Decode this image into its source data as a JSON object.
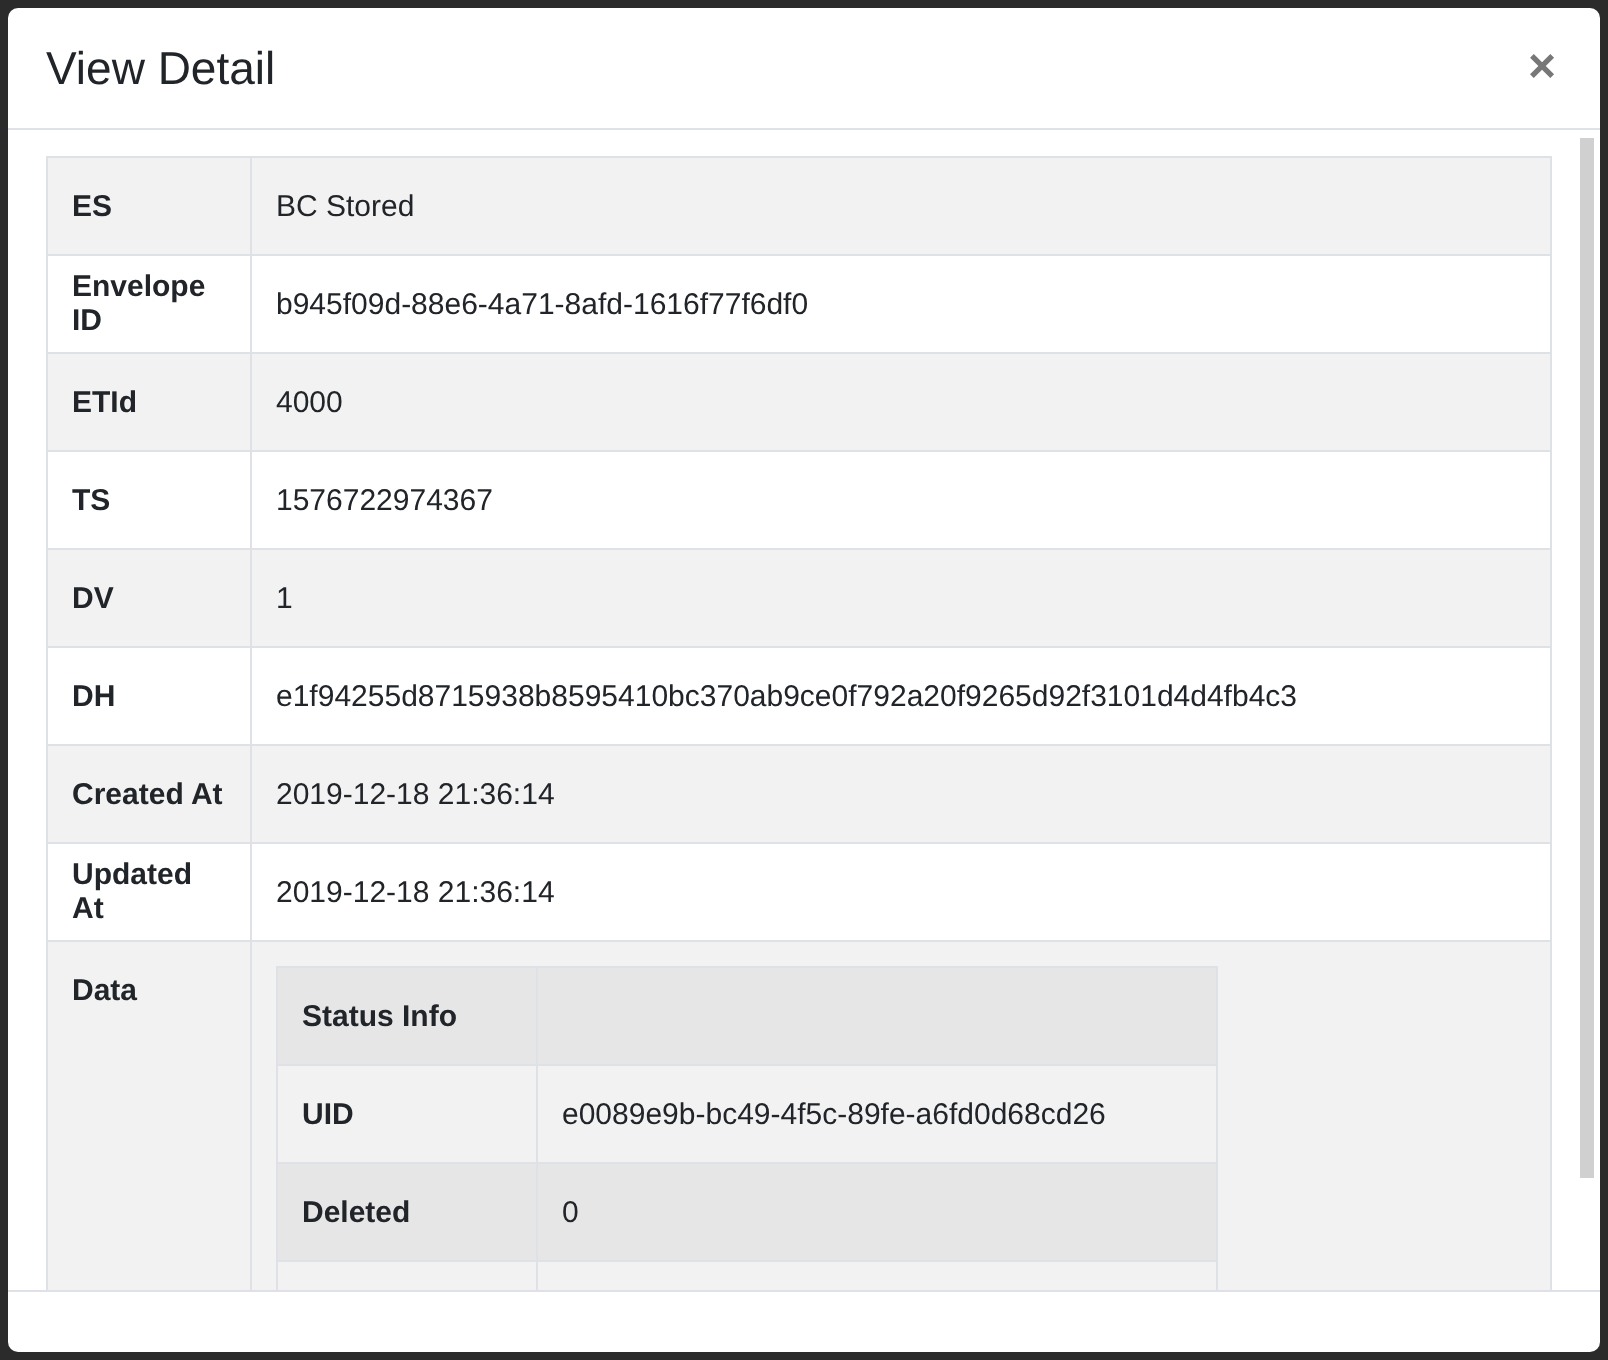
{
  "modal": {
    "title": "View Detail",
    "close": "×"
  },
  "rows": [
    {
      "label": "ES",
      "value": "BC Stored"
    },
    {
      "label": "Envelope ID",
      "value": "b945f09d-88e6-4a71-8afd-1616f77f6df0"
    },
    {
      "label": "ETId",
      "value": "4000"
    },
    {
      "label": "TS",
      "value": "1576722974367"
    },
    {
      "label": "DV",
      "value": "1"
    },
    {
      "label": "DH",
      "value": "e1f94255d8715938b8595410bc370ab9ce0f792a20f9265d92f3101d4d4fb4c3"
    },
    {
      "label": "Created At",
      "value": "2019-12-18 21:36:14"
    },
    {
      "label": "Updated At",
      "value": "2019-12-18 21:36:14"
    },
    {
      "label": "Data",
      "table": [
        {
          "label": "Status Info"
        },
        {
          "label": "UID",
          "value": "e0089e9b-bc49-4f5c-89fe-a6fd0d68cd26"
        },
        {
          "label": "Deleted",
          "value": "0"
        }
      ]
    }
  ]
}
